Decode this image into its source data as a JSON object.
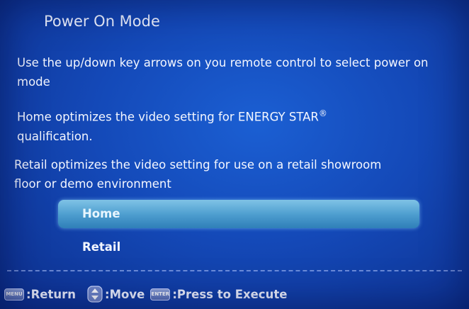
{
  "title": "Power On Mode",
  "paragraphs": {
    "instruction": "Use the up/down key arrows on you remote control to select power on mode",
    "home_desc_main": "Home optimizes the video setting for ENERGY STAR",
    "home_desc_mark": "®",
    "home_desc_end": "qualification.",
    "retail_desc": "Retail optimizes the video setting for use on a retail showroom floor or demo environment"
  },
  "options": [
    {
      "label": "Home",
      "selected": true
    },
    {
      "label": "Retail",
      "selected": false
    }
  ],
  "footer": {
    "menu_key": "MENU",
    "return_label": ":Return",
    "move_label": ":Move",
    "enter_key": "ENTER",
    "execute_label": ":Press to Execute"
  },
  "colors": {
    "background": "#1449b8",
    "selected_option": "#4f9fd0"
  },
  "icons": {
    "menu": "menu-key-icon",
    "move": "up-down-arrows-icon",
    "enter": "enter-key-icon"
  }
}
